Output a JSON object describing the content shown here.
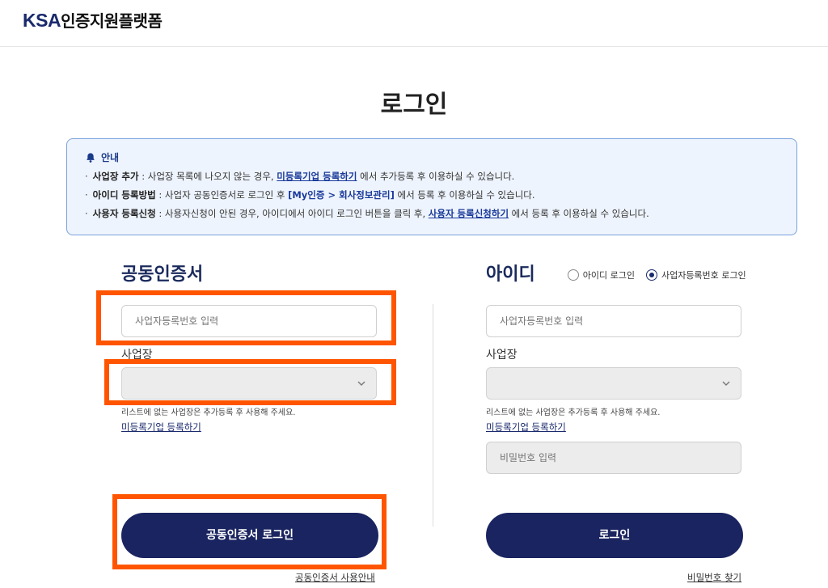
{
  "header": {
    "logo_ksa": "KSA",
    "logo_text": "인증지원플랫폼"
  },
  "page": {
    "title": "로그인"
  },
  "notice": {
    "title": "안내",
    "lines": [
      {
        "bullet": "·",
        "label": "사업장 추가",
        "text1": " : 사업장 목록에 나오지 않는 경우, ",
        "link": "미등록기업 등록하기",
        "text2": " 에서 추가등록 후 이용하실 수 있습니다."
      },
      {
        "bullet": "·",
        "label": "아이디 등록방법",
        "text1": " : 사업자 공동인증서로 로그인 후 ",
        "link": "[My인증 > 회사정보관리]",
        "text2": " 에서 등록 후 이용하실 수 있습니다."
      },
      {
        "bullet": "·",
        "label": "사용자 등록신청",
        "text1": " : 사용자신청이 안된 경우, 아이디에서 아이디 로그인 버튼을 클릭 후, ",
        "link": "사용자 등록신청하기",
        "text2": " 에서 등록 후 이용하실 수 있습니다."
      }
    ]
  },
  "cert": {
    "title": "공동인증서",
    "bizno_placeholder": "사업자등록번호 입력",
    "site_label": "사업장",
    "hint": "리스트에 없는 사업장은 추가등록 후 사용해 주세요.",
    "register_link": "미등록기업 등록하기",
    "login_button": "공동인증서 로그인",
    "guide_link": "공동인증서 사용안내"
  },
  "id": {
    "title": "아이디",
    "radio_id": "아이디 로그인",
    "radio_bizno": "사업자등록번호 로그인",
    "selected": "radio_bizno",
    "bizno_placeholder": "사업자등록번호 입력",
    "site_label": "사업장",
    "hint": "리스트에 없는 사업장은 추가등록 후 사용해 주세요.",
    "register_link": "미등록기업 등록하기",
    "password_placeholder": "비밀번호 입력",
    "login_button": "로그인",
    "find_pw_link": "비밀번호 찾기"
  },
  "colors": {
    "accent": "#1a2460",
    "highlight": "#ff5500",
    "notice_bg": "#eef4fd",
    "link": "#1a3a9a"
  }
}
